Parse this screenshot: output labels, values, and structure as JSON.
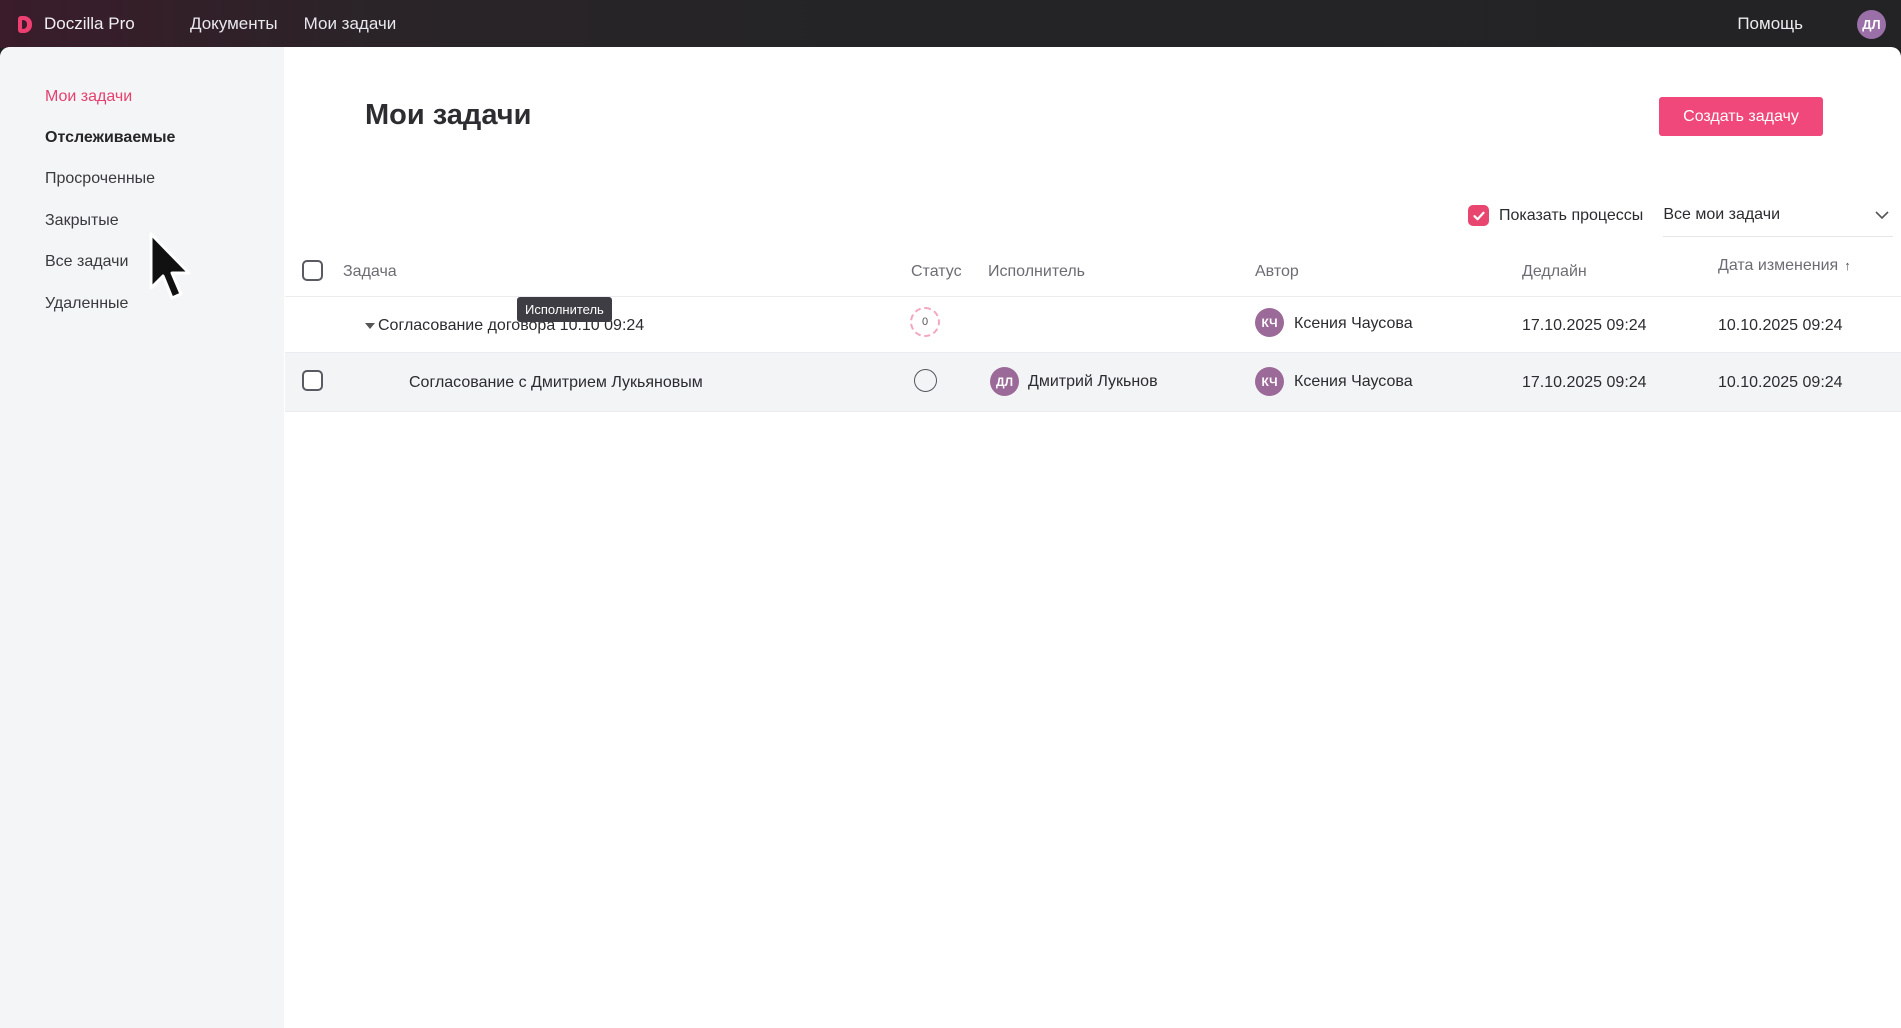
{
  "topbar": {
    "brand": "Doczilla Pro",
    "nav": [
      "Документы",
      "Мои задачи"
    ],
    "help": "Помощь",
    "user_initials": "ДЛ"
  },
  "sidebar": {
    "items": [
      {
        "label": "Мои задачи",
        "state": "active"
      },
      {
        "label": "Отслеживаемые",
        "state": "bold"
      },
      {
        "label": "Просроченные",
        "state": "normal"
      },
      {
        "label": "Закрытые",
        "state": "normal"
      },
      {
        "label": "Все задачи",
        "state": "normal"
      },
      {
        "label": "Удаленные",
        "state": "normal"
      }
    ]
  },
  "main": {
    "title": "Мои задачи",
    "create_button": "Создать задачу",
    "show_processes_label": "Показать процессы",
    "show_processes_checked": true,
    "filter_selected": "Все мои задачи"
  },
  "table": {
    "columns": [
      "Задача",
      "Статус",
      "Исполнитель",
      "Автор",
      "Дедлайн",
      "Дата изменения"
    ],
    "sort_column": "Дата изменения",
    "sort_icon": "arrow-up-icon",
    "rows": [
      {
        "task": "Согласование договора 10.10 09:24",
        "status": "0",
        "assignee_initials": "",
        "assignee": "",
        "author_initials": "КЧ",
        "author": "Ксения Чаусова",
        "deadline": "17.10.2025 09:24",
        "modified": "10.10.2025 09:24"
      },
      {
        "task": "Согласование с Дмитрием Лукьяновым",
        "status": "",
        "assignee_initials": "ДЛ",
        "assignee": "Дмитрий Лукьнов",
        "author_initials": "КЧ",
        "author": "Ксения Чаусова",
        "deadline": "17.10.2025 09:24",
        "modified": "10.10.2025 09:24"
      }
    ]
  },
  "tooltip": "Исполнитель",
  "colors": {
    "accent": "#f0487a",
    "avatar": "#9b6a98",
    "topbar": "#242426"
  }
}
